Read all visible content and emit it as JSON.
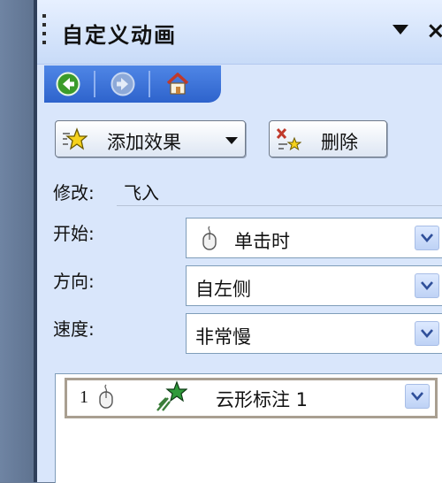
{
  "panel": {
    "title": "自定义动画"
  },
  "toolbar": {
    "add_effect_label": "添加效果",
    "delete_label": "删除"
  },
  "modify": {
    "label": "修改:",
    "value": "飞入"
  },
  "fields": {
    "start": {
      "label": "开始:",
      "value": "单击时"
    },
    "direction": {
      "label": "方向:",
      "value": "自左侧"
    },
    "speed": {
      "label": "速度:",
      "value": "非常慢"
    }
  },
  "animation_list": [
    {
      "order": "1",
      "name": "云形标注 1"
    }
  ],
  "icons": {
    "back": "back-arrow-icon",
    "forward": "forward-arrow-icon",
    "home": "home-icon",
    "add_effect": "star-icon",
    "delete": "delete-x-icon",
    "mouse": "mouse-icon",
    "effect": "green-star-icon"
  },
  "colors": {
    "pane_background": "#d9e6fb",
    "nav_bar": "#2e63cc",
    "back_button": "#3b9b2a",
    "dropdown_button": "#bed2f5"
  }
}
